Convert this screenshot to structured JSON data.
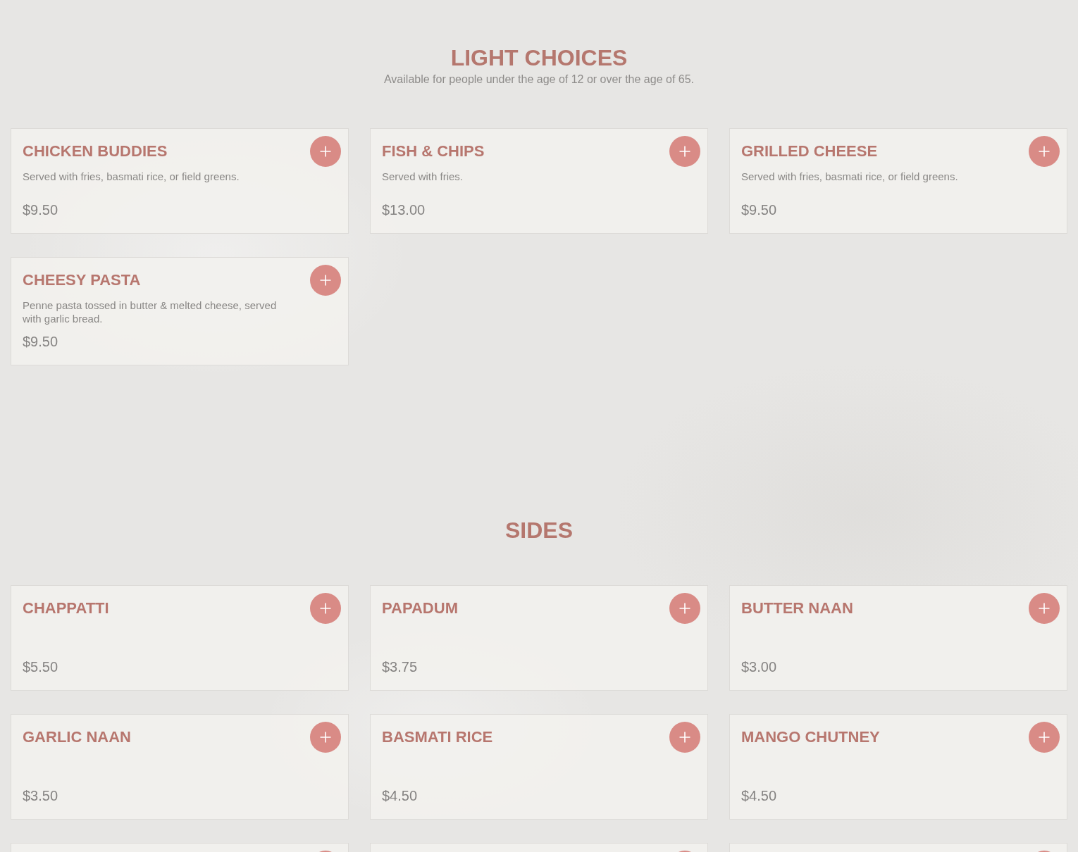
{
  "sections": [
    {
      "title": "LIGHT CHOICES",
      "subtitle": "Available for people under the age of 12 or over the age of 65.",
      "items": [
        {
          "kind": "dish",
          "name": "CHICKEN BUDDIES",
          "description": "Served with fries, basmati rice, or field greens.",
          "price": "$9.50"
        },
        {
          "kind": "dish",
          "name": "FISH & CHIPS",
          "description": "Served with fries.",
          "price": "$13.00"
        },
        {
          "kind": "dish",
          "name": "GRILLED CHEESE",
          "description": "Served with fries, basmati rice, or field greens.",
          "price": "$9.50"
        },
        {
          "kind": "dish",
          "name": "CHEESY PASTA",
          "description": "Penne pasta tossed in butter & melted cheese, served with garlic bread.",
          "price": "$9.50"
        }
      ]
    },
    {
      "title": "SIDES",
      "items": [
        {
          "kind": "dish",
          "name": "CHAPPATTI",
          "price": "$5.50"
        },
        {
          "kind": "dish",
          "name": "PAPADUM",
          "price": "$3.75"
        },
        {
          "kind": "dish",
          "name": "BUTTER NAAN",
          "price": "$3.00"
        },
        {
          "kind": "dish",
          "name": "GARLIC NAAN",
          "price": "$3.50"
        },
        {
          "kind": "dish",
          "name": "BASMATI RICE",
          "price": "$4.50"
        },
        {
          "kind": "dish",
          "name": "MANGO CHUTNEY",
          "price": "$4.50"
        },
        {
          "kind": "cut_off"
        },
        {
          "kind": "cut_off"
        },
        {
          "kind": "cut_off"
        }
      ]
    }
  ]
}
